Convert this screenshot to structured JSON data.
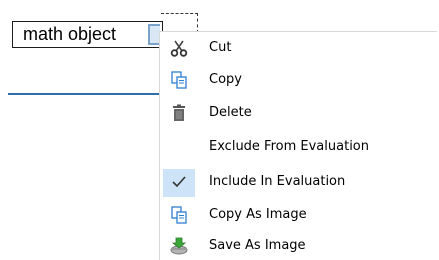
{
  "worksheet": {
    "math_object_text": "math object"
  },
  "context_menu": {
    "items": [
      {
        "label": "Cut",
        "icon": "scissors-icon"
      },
      {
        "label": "Copy",
        "icon": "copy-icon"
      },
      {
        "label": "Delete",
        "icon": "trash-icon"
      },
      {
        "label": "Exclude From Evaluation",
        "icon": ""
      },
      {
        "label": "Include In Evaluation",
        "icon": "checkmark-icon",
        "checked": true
      },
      {
        "label": "Copy As Image",
        "icon": "copy-image-icon"
      },
      {
        "label": "Save As Image",
        "icon": "save-image-icon"
      }
    ]
  },
  "colors": {
    "accent": "#2f6ea6",
    "check_highlight": "#cde3f7",
    "copy_icon_blue": "#2f7fd0"
  }
}
